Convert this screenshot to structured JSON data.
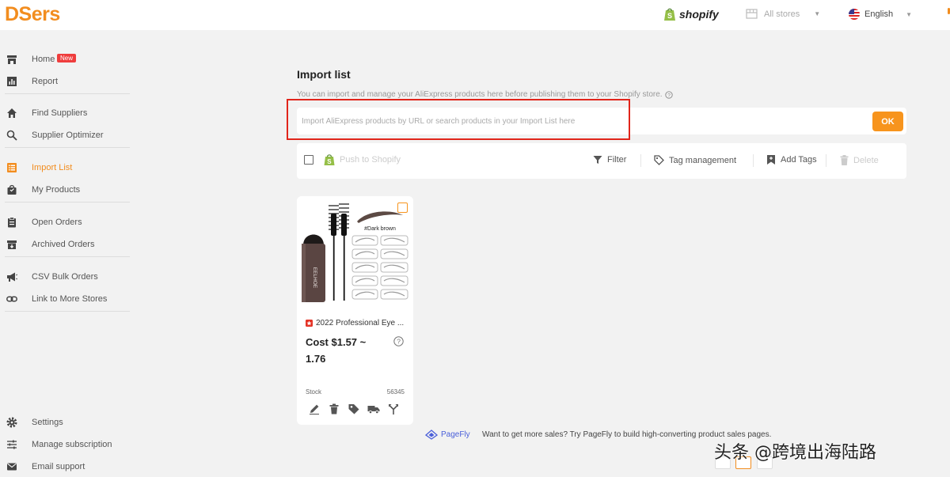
{
  "header": {
    "logo": "DSers",
    "platform": "shopify",
    "store_selector": "All stores",
    "language": "English"
  },
  "sidebar": {
    "items": [
      {
        "label": "Home",
        "badge": "New"
      },
      {
        "label": "Report"
      },
      {
        "label": "Find Suppliers"
      },
      {
        "label": "Supplier Optimizer"
      },
      {
        "label": "Import List",
        "active": true
      },
      {
        "label": "My Products"
      },
      {
        "label": "Open Orders"
      },
      {
        "label": "Archived Orders"
      },
      {
        "label": "CSV Bulk Orders"
      },
      {
        "label": "Link to More Stores"
      },
      {
        "label": "Settings"
      },
      {
        "label": "Manage subscription"
      },
      {
        "label": "Email support"
      }
    ]
  },
  "main": {
    "title": "Import list",
    "description": "You can import and manage your AliExpress products here before publishing them to your Shopify store.",
    "search": {
      "placeholder": "Import AliExpress products by URL or search products in your Import List here",
      "value": "",
      "ok_label": "OK"
    },
    "toolbar": {
      "push_label": "Push to Shopify",
      "filter_label": "Filter",
      "tag_management_label": "Tag management",
      "add_tags_label": "Add Tags",
      "delete_label": "Delete"
    }
  },
  "product": {
    "title": "2022 Professional Eye ...",
    "cost": "Cost $1.57 ~ 1.76",
    "stock_label": "Stock",
    "stock_value": "56345",
    "image_caption": "#Dark brown",
    "brand_text": "EELHOE"
  },
  "footer": {
    "pagefly_brand": "PageFly",
    "promo": "Want to get more sales? Try PageFly to build high-converting product sales pages.",
    "watermark": "头条 @跨境出海陆路"
  },
  "colors": {
    "accent": "#f28d1f",
    "highlight_box": "#e1251b",
    "badge": "#ef3d3d",
    "pagefly": "#4a5fd9"
  }
}
